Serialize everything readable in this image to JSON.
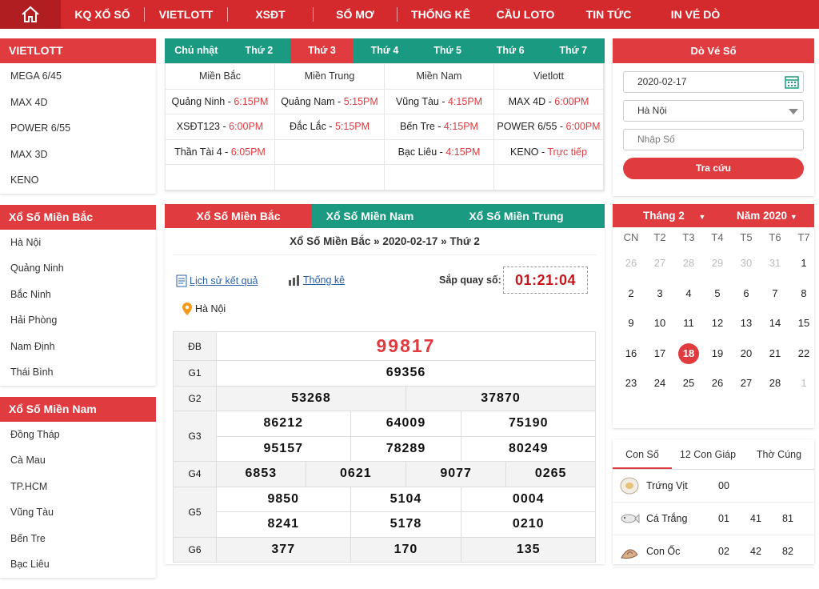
{
  "nav": {
    "items": [
      "KQ XỔ SỐ",
      "VIETLOTT",
      "XSĐT",
      "SỔ MƠ",
      "THỐNG KÊ",
      "CẦU LOTO",
      "TIN TỨC",
      "IN VÉ DÒ"
    ]
  },
  "left": {
    "vietlott": {
      "title": "VIETLOTT",
      "items": [
        "MEGA 6/45",
        "MAX 4D",
        "POWER 6/55",
        "MAX 3D",
        "KENO"
      ]
    },
    "bac": {
      "title": "Xổ Số Miền Bắc",
      "items": [
        "Hà Nội",
        "Quảng Ninh",
        "Bắc Ninh",
        "Hải Phòng",
        "Nam Định",
        "Thái Bình"
      ]
    },
    "nam": {
      "title": "Xổ Số Miền Nam",
      "items": [
        "Đồng Tháp",
        "Cà Mau",
        "TP.HCM",
        "Vũng Tàu",
        "Bến Tre",
        "Bạc Liêu"
      ]
    }
  },
  "days": [
    "Chủ nhật",
    "Thứ 2",
    "Thứ 3",
    "Thứ 4",
    "Thứ 5",
    "Thứ 6",
    "Thứ 7"
  ],
  "schedule": {
    "headers": [
      "Miền Bắc",
      "Miền Trung",
      "Miền Nam",
      "Vietlott"
    ],
    "rows": [
      [
        {
          "n": "Quảng Ninh - ",
          "t": "6:15PM"
        },
        {
          "n": "Quảng Nam - ",
          "t": "5:15PM"
        },
        {
          "n": "Vũng Tàu - ",
          "t": "4:15PM"
        },
        {
          "n": "MAX 4D - ",
          "t": "6:00PM"
        }
      ],
      [
        {
          "n": "XSĐT123 - ",
          "t": "6:00PM"
        },
        {
          "n": "Đắc Lắc - ",
          "t": "5:15PM"
        },
        {
          "n": "Bến Tre - ",
          "t": "4:15PM"
        },
        {
          "n": "POWER 6/55 - ",
          "t": "6:00PM"
        }
      ],
      [
        {
          "n": "Thần Tài 4 - ",
          "t": "6:05PM"
        },
        {
          "n": "",
          "t": ""
        },
        {
          "n": "Bạc Liêu - ",
          "t": "4:15PM"
        },
        {
          "n": "KENO - ",
          "t": "Trực tiếp"
        }
      ],
      [
        {
          "n": "",
          "t": ""
        },
        {
          "n": "",
          "t": ""
        },
        {
          "n": "",
          "t": ""
        },
        {
          "n": "",
          "t": ""
        }
      ]
    ]
  },
  "region_tabs": [
    "Xổ Số Miền Bắc",
    "Xổ Số Miền Nam",
    "Xổ Số Miền Trung"
  ],
  "result": {
    "title": "Xổ Số Miền Bắc » 2020-02-17 » Thứ 2",
    "history_link": "Lịch sử kết quả",
    "stats_link": "Thống kê",
    "countdown_label": "Sắp quay số:",
    "countdown": "01:21:04",
    "location": "Hà Nội",
    "prizes": [
      {
        "label": "ĐB",
        "rows": [
          [
            "99817"
          ]
        ]
      },
      {
        "label": "G1",
        "rows": [
          [
            "69356"
          ]
        ]
      },
      {
        "label": "G2",
        "rows": [
          [
            "53268",
            "37870"
          ]
        ]
      },
      {
        "label": "G3",
        "rows": [
          [
            "86212",
            "64009",
            "75190"
          ],
          [
            "95157",
            "78289",
            "80249"
          ]
        ]
      },
      {
        "label": "G4",
        "rows": [
          [
            "6853",
            "0621",
            "9077",
            "0265"
          ]
        ]
      },
      {
        "label": "G5",
        "rows": [
          [
            "9850",
            "5104",
            "0004"
          ],
          [
            "8241",
            "5178",
            "0210"
          ]
        ]
      },
      {
        "label": "G6",
        "rows": [
          [
            "377",
            "170",
            "135"
          ]
        ]
      }
    ]
  },
  "dove": {
    "title": "Dò Vé Số",
    "date": "2020-02-17",
    "province": "Hà Nội",
    "number_placeholder": "Nhập Số",
    "button": "Tra cứu"
  },
  "calendar": {
    "month": "Tháng 2",
    "year": "Năm 2020",
    "weekdays": [
      "CN",
      "T2",
      "T3",
      "T4",
      "T5",
      "T6",
      "T7"
    ],
    "days": [
      [
        "26",
        "27",
        "28",
        "29",
        "30",
        "31",
        "1"
      ],
      [
        "2",
        "3",
        "4",
        "5",
        "6",
        "7",
        "8"
      ],
      [
        "9",
        "10",
        "11",
        "12",
        "13",
        "14",
        "15"
      ],
      [
        "16",
        "17",
        "18",
        "19",
        "20",
        "21",
        "22"
      ],
      [
        "23",
        "24",
        "25",
        "26",
        "27",
        "28",
        "1"
      ]
    ],
    "today": "18"
  },
  "dream": {
    "tabs": [
      "Con Số",
      "12 Con Giáp",
      "Thờ Cúng"
    ],
    "rows": [
      {
        "name": "Trứng Vịt",
        "nums": [
          "00"
        ]
      },
      {
        "name": "Cá Trắng",
        "nums": [
          "01",
          "41",
          "81"
        ]
      },
      {
        "name": "Con Ốc",
        "nums": [
          "02",
          "42",
          "82"
        ]
      }
    ]
  },
  "colors": {
    "red": "#e03b3f",
    "green": "#1b9a82",
    "nav": "#d42a2e"
  }
}
